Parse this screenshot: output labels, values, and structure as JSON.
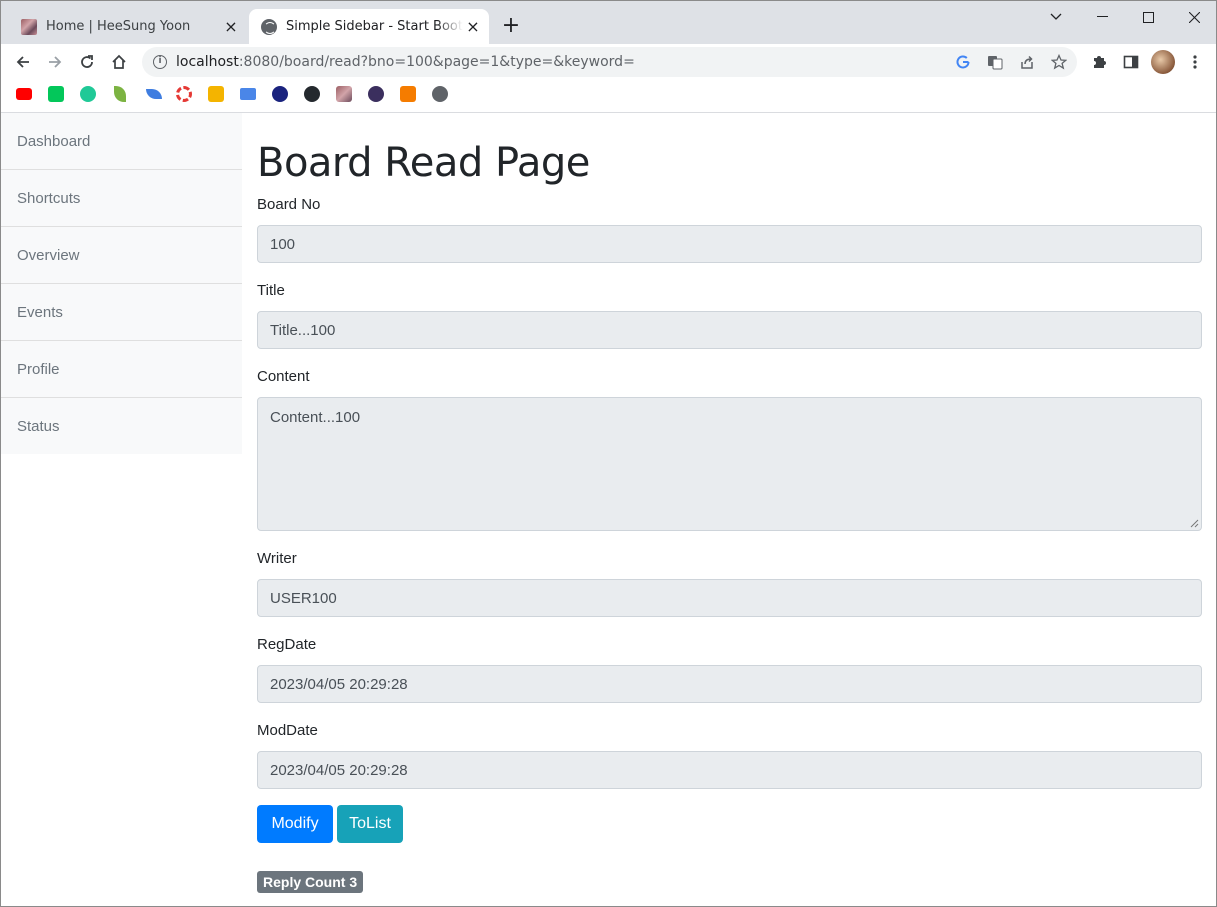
{
  "browser": {
    "tabs": [
      {
        "title": "Home | HeeSung Yoon",
        "active": false,
        "favicon": "photo-icon"
      },
      {
        "title": "Simple Sidebar - Start Bootstrap",
        "active": true,
        "favicon": "globe-icon"
      }
    ],
    "new_tab_label": "+",
    "close_glyph": "×",
    "url": {
      "host": "localhost",
      "path": ":8080/board/read?bno=100&page=1&type=&keyword="
    },
    "bookmarks": [
      {
        "icon": "youtube-icon",
        "color": "#ff0000"
      },
      {
        "icon": "naver-icon",
        "color": "#03c75a"
      },
      {
        "icon": "green-circle-icon",
        "color": "#20c997"
      },
      {
        "icon": "leaf-icon",
        "color": "#7cb342"
      },
      {
        "icon": "feather-icon",
        "color": "#3f7de0"
      },
      {
        "icon": "ring-icon",
        "color": "#e53935"
      },
      {
        "icon": "classroom-icon",
        "color": "#f4b400"
      },
      {
        "icon": "blue-square-icon",
        "color": "#4a86e8"
      },
      {
        "icon": "owl-icon",
        "color": "#1a237e"
      },
      {
        "icon": "github-icon",
        "color": "#24292e"
      },
      {
        "icon": "photo-icon",
        "color": "#9b5e63"
      },
      {
        "icon": "character-icon",
        "color": "#3b2f5e"
      },
      {
        "icon": "orange-cube-icon",
        "color": "#f57c00"
      },
      {
        "icon": "globe-icon",
        "color": "#5f6368"
      }
    ]
  },
  "sidebar": {
    "items": [
      {
        "label": "Dashboard"
      },
      {
        "label": "Shortcuts"
      },
      {
        "label": "Overview"
      },
      {
        "label": "Events"
      },
      {
        "label": "Profile"
      },
      {
        "label": "Status"
      }
    ]
  },
  "main": {
    "title": "Board Read Page",
    "fields": {
      "bno": {
        "label": "Board No",
        "value": "100"
      },
      "title": {
        "label": "Title",
        "value": "Title...100"
      },
      "content": {
        "label": "Content",
        "value": "Content...100"
      },
      "writer": {
        "label": "Writer",
        "value": "USER100"
      },
      "regdate": {
        "label": "RegDate",
        "value": "2023/04/05 20:29:28"
      },
      "moddate": {
        "label": "ModDate",
        "value": "2023/04/05 20:29:28"
      }
    },
    "buttons": {
      "modify": "Modify",
      "tolist": "ToList"
    },
    "reply_badge": "Reply Count 3"
  },
  "colors": {
    "primary": "#007bff",
    "info": "#17a2b8",
    "secondary": "#6c757d",
    "readonly_bg": "#e9ecef"
  }
}
